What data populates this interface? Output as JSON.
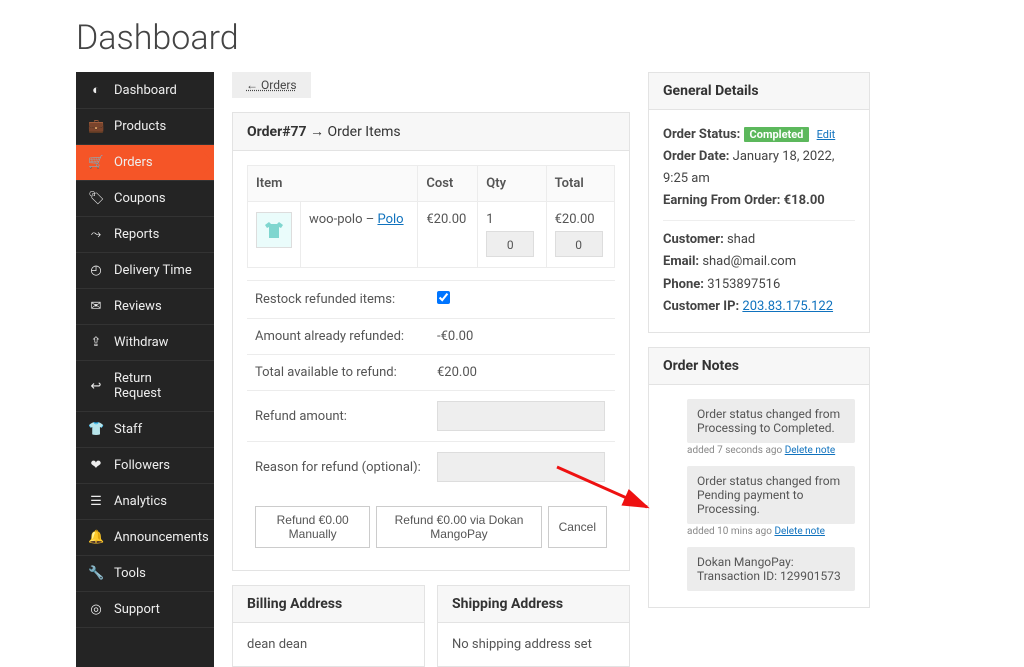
{
  "page_title": "Dashboard",
  "back_orders": "← Orders",
  "sidebar": {
    "items": [
      {
        "label": "Dashboard",
        "icon": "gauge"
      },
      {
        "label": "Products",
        "icon": "briefcase"
      },
      {
        "label": "Orders",
        "icon": "cart",
        "active": true
      },
      {
        "label": "Coupons",
        "icon": "tags"
      },
      {
        "label": "Reports",
        "icon": "chart"
      },
      {
        "label": "Delivery Time",
        "icon": "clock"
      },
      {
        "label": "Reviews",
        "icon": "comment"
      },
      {
        "label": "Withdraw",
        "icon": "upload"
      },
      {
        "label": "Return Request",
        "icon": "undo"
      },
      {
        "label": "Staff",
        "icon": "tshirt"
      },
      {
        "label": "Followers",
        "icon": "heart"
      },
      {
        "label": "Analytics",
        "icon": "bars"
      },
      {
        "label": "Announcements",
        "icon": "bell"
      },
      {
        "label": "Tools",
        "icon": "wrench"
      },
      {
        "label": "Support",
        "icon": "life-ring"
      }
    ]
  },
  "order_panel": {
    "title_strong": "Order#77",
    "title_rest": " → Order Items",
    "headers": {
      "item": "Item",
      "cost": "Cost",
      "qty": "Qty",
      "total": "Total"
    },
    "line": {
      "name_prefix": "woo-polo – ",
      "name_link": "Polo",
      "cost": "€20.00",
      "qty": "1",
      "qty_refund": "0",
      "total": "€20.00",
      "total_refund": "0"
    },
    "refund": {
      "restock_label": "Restock refunded items:",
      "restock_checked": true,
      "already_label": "Amount already refunded:",
      "already_val": "-€0.00",
      "available_label": "Total available to refund:",
      "available_val": "€20.00",
      "amount_label": "Refund amount:",
      "reason_label": "Reason for refund (optional):"
    },
    "buttons": {
      "manual": "Refund €0.00 Manually",
      "mangopay": "Refund €0.00 via Dokan MangoPay",
      "cancel": "Cancel"
    }
  },
  "billing": {
    "header": "Billing Address",
    "body": "dean dean"
  },
  "shipping": {
    "header": "Shipping Address",
    "body": "No shipping address set"
  },
  "general": {
    "header": "General Details",
    "status_label": "Order Status: ",
    "status_badge": "Completed",
    "edit": "Edit",
    "date_label": "Order Date: ",
    "date_val": "January 18, 2022, 9:25 am",
    "earning_label": "Earning From Order: ",
    "earning_val": "€18.00",
    "customer_label": "Customer: ",
    "customer_val": "shad",
    "email_label": "Email: ",
    "email_val": "shad@mail.com",
    "phone_label": "Phone: ",
    "phone_val": "3153897516",
    "ip_label": "Customer IP: ",
    "ip_val": "203.83.175.122"
  },
  "notes": {
    "header": "Order Notes",
    "items": [
      {
        "text": "Order status changed from Processing to Completed.",
        "meta_prefix": "added 7 seconds ago ",
        "delete": "Delete note"
      },
      {
        "text": "Order status changed from Pending payment to Processing.",
        "meta_prefix": "added 10 mins ago ",
        "delete": "Delete note"
      },
      {
        "text": "Dokan MangoPay: Transaction ID: 129901573",
        "meta_prefix": "",
        "delete": ""
      }
    ]
  },
  "icons": {
    "gauge": "◉",
    "briefcase": "💼",
    "cart": "🛒",
    "tags": "🏷",
    "chart": "📈",
    "clock": "⏱",
    "comment": "💬",
    "upload": "⬆",
    "undo": "↩",
    "tshirt": "👕",
    "heart": "♥",
    "bars": "📊",
    "bell": "🔔",
    "wrench": "🔧",
    "life-ring": "⛑"
  }
}
